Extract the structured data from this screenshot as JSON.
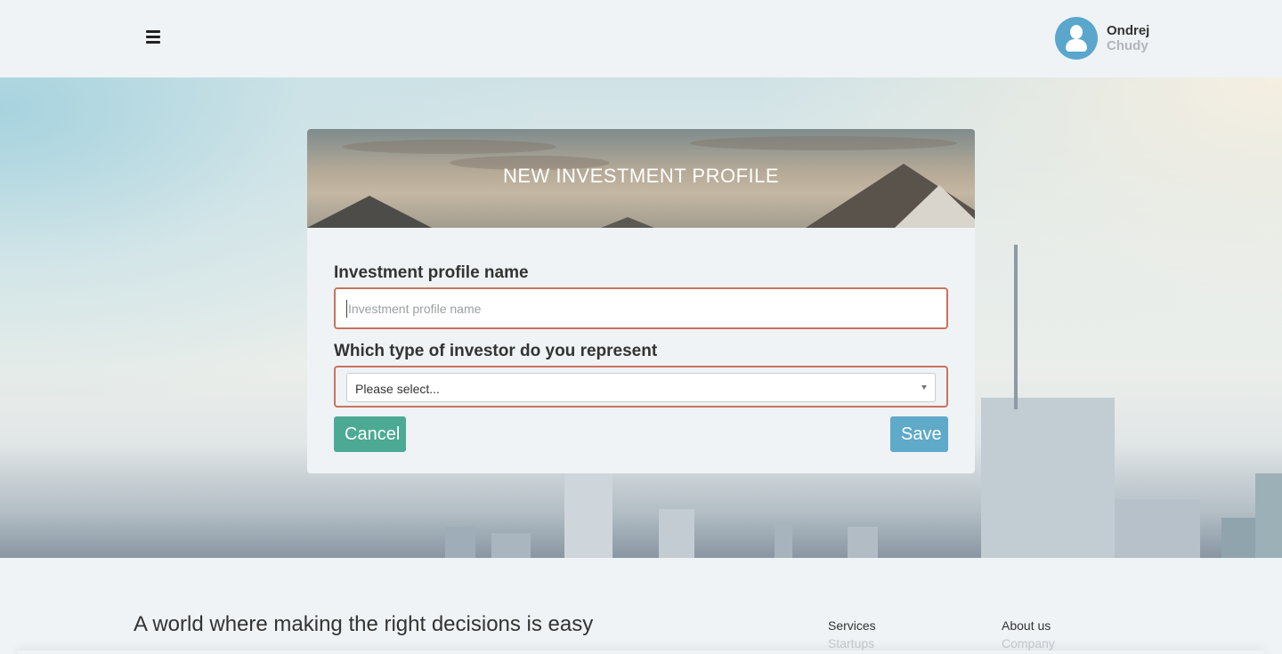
{
  "header": {
    "menu_icon": "hamburger-menu-icon",
    "user": {
      "first_name": "Ondrej",
      "last_name": "Chudy",
      "avatar_icon": "user-avatar-icon"
    }
  },
  "form": {
    "title": "NEW INVESTMENT PROFILE",
    "profile_name": {
      "label": "Investment profile name",
      "placeholder": "Investment profile name",
      "value": ""
    },
    "investor_type": {
      "label": "Which type of investor do you represent",
      "selected": "Please select..."
    },
    "cancel_label": "Cancel",
    "save_label": "Save",
    "colors": {
      "error_border": "#c8735f",
      "cancel": "#4caa94",
      "save": "#5fa9c9"
    }
  },
  "footer": {
    "tagline": "A world where making the right decisions is easy",
    "columns": [
      {
        "heading": "Services",
        "links": [
          "Startups"
        ]
      },
      {
        "heading": "About us",
        "links": [
          "Company"
        ]
      }
    ]
  }
}
